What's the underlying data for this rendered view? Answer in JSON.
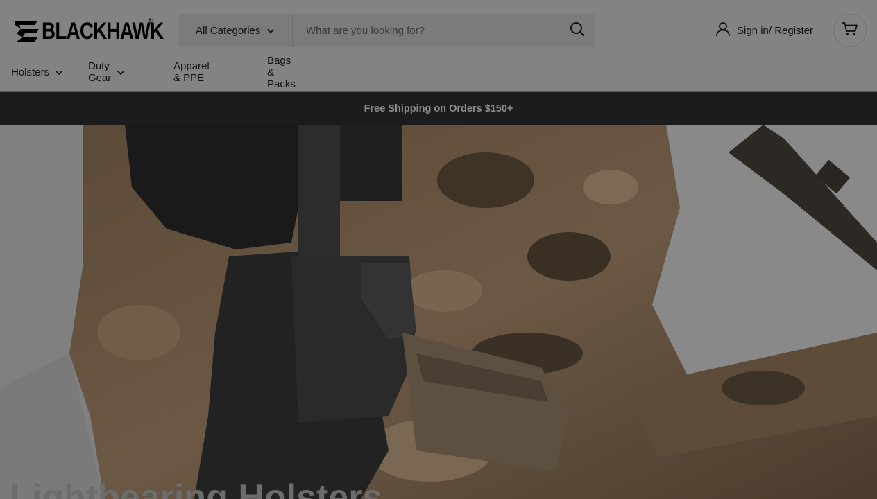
{
  "brand": {
    "name": "BLACKHAWK",
    "reg": "®"
  },
  "search": {
    "category_label": "All Categories",
    "placeholder": "What are you looking for?",
    "value": ""
  },
  "account": {
    "signin_label": "Sign in/ Register"
  },
  "nav": {
    "items": [
      {
        "label": "Holsters",
        "has_dropdown": true
      },
      {
        "label": "Duty Gear",
        "has_dropdown": true
      },
      {
        "label": "Apparel & PPE",
        "has_dropdown": false
      },
      {
        "label": "Bags & Packs",
        "has_dropdown": false
      }
    ]
  },
  "promo": {
    "text": "Free Shipping on Orders $150+"
  },
  "hero": {
    "title": "Lightbearing Holsters"
  },
  "icons": {
    "search": "search-icon",
    "user": "user-icon",
    "cart": "cart-icon",
    "chevron": "chevron-down-icon"
  },
  "colors": {
    "header_bg": "#838383",
    "promo_bg": "#1c1c1c",
    "promo_text": "#8c8c8c",
    "text": "#111111"
  }
}
